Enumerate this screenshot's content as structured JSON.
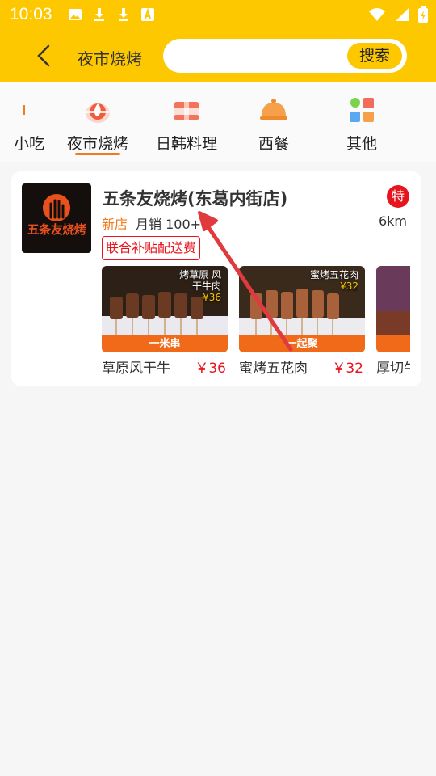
{
  "status_bar": {
    "time": "10:03"
  },
  "header": {
    "title": "夜市烧烤",
    "search_placeholder": "",
    "search_button": "搜索"
  },
  "categories": [
    {
      "label": "小吃",
      "icon": "snack-icon"
    },
    {
      "label": "夜市烧烤",
      "icon": "bbq-icon",
      "active": true
    },
    {
      "label": "日韩料理",
      "icon": "sushi-icon"
    },
    {
      "label": "西餐",
      "icon": "cloche-icon"
    },
    {
      "label": "其他",
      "icon": "grid-icon"
    }
  ],
  "shop": {
    "logo_text": "五条友烧烤",
    "name": "五条友烧烤(东葛内街店)",
    "badge": "特",
    "new_tag": "新店",
    "monthly_sales": "月销 100+",
    "distance": "6km",
    "promo": "联合补贴配送费",
    "items": [
      {
        "name": "草原风干牛",
        "price": "￥36",
        "banner": "一米串",
        "overlay_title": "烤草原 风干牛肉",
        "overlay_price": "¥36"
      },
      {
        "name": "蜜烤五花肉",
        "price": "￥32",
        "banner": "一起聚",
        "overlay_title": "蜜烤五花肉",
        "overlay_price": "¥32"
      },
      {
        "name": "厚切牛",
        "price": "",
        "banner": "",
        "overlay_title": "",
        "overlay_price": ""
      }
    ]
  },
  "colors": {
    "brand": "#fdc800",
    "accent": "#f07a1e",
    "price": "#e8141d",
    "arrow": "#e0393e"
  }
}
